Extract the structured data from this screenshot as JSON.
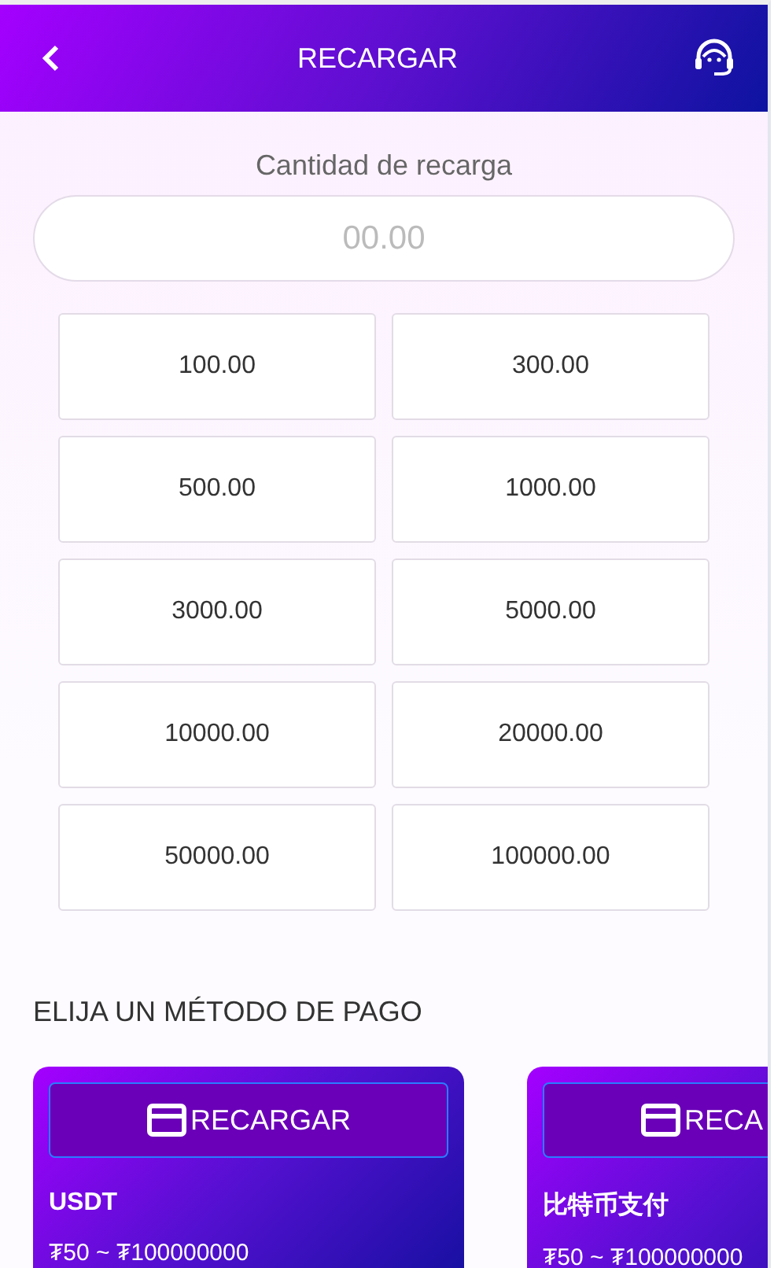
{
  "header": {
    "title": "RECARGAR"
  },
  "amount": {
    "label": "Cantidad de recarga",
    "placeholder": "00.00"
  },
  "presets": [
    {
      "label": "100.00",
      "selected": false
    },
    {
      "label": "300.00",
      "selected": false
    },
    {
      "label": "500.00",
      "selected": false
    },
    {
      "label": "1000.00",
      "selected": false
    },
    {
      "label": "3000.00",
      "selected": false
    },
    {
      "label": "5000.00",
      "selected": false
    },
    {
      "label": "10000.00",
      "selected": false
    },
    {
      "label": "20000.00",
      "selected": false
    },
    {
      "label": "50000.00",
      "selected": false
    },
    {
      "label": "100000.00",
      "selected": false
    }
  ],
  "methods_title": "ELIJA UN MÉTODO DE PAGO",
  "methods": [
    {
      "button": "RECARGAR",
      "name": "USDT",
      "range": "₮50 ~ ₮100000000"
    },
    {
      "button": "RECA",
      "name": "比特币支付",
      "range": "₮50 ~ ₮100000000"
    }
  ]
}
